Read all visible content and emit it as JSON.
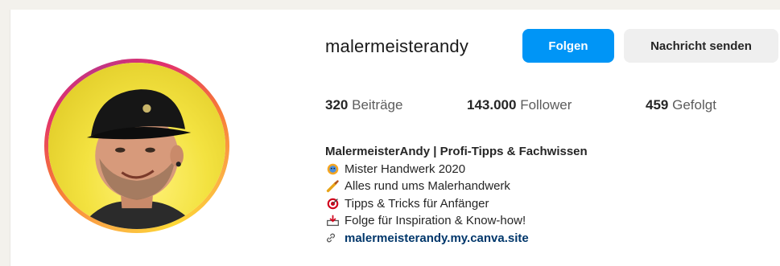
{
  "profile": {
    "username": "malermeisterandy",
    "follow_label": "Folgen",
    "message_label": "Nachricht senden"
  },
  "stats": {
    "posts_count": "320",
    "posts_label": "Beiträge",
    "followers_count": "143.000",
    "followers_label": "Follower",
    "following_count": "459",
    "following_label": "Gefolgt"
  },
  "bio": {
    "name": "MalermeisterAndy | Profi-Tipps & Fachwissen",
    "lines": [
      {
        "icon": "medal-icon",
        "text": "Mister Handwerk 2020"
      },
      {
        "icon": "paintbrush-icon",
        "text": "Alles rund ums Malerhandwerk"
      },
      {
        "icon": "target-icon",
        "text": "Tipps & Tricks für Anfänger"
      },
      {
        "icon": "inbox-tray-icon",
        "text": "Folge für Inspiration & Know-how!"
      }
    ],
    "link": "malermeisterandy.my.canva.site"
  },
  "colors": {
    "follow_button": "#0095f6",
    "message_button": "#efefef",
    "link": "#00376b"
  }
}
